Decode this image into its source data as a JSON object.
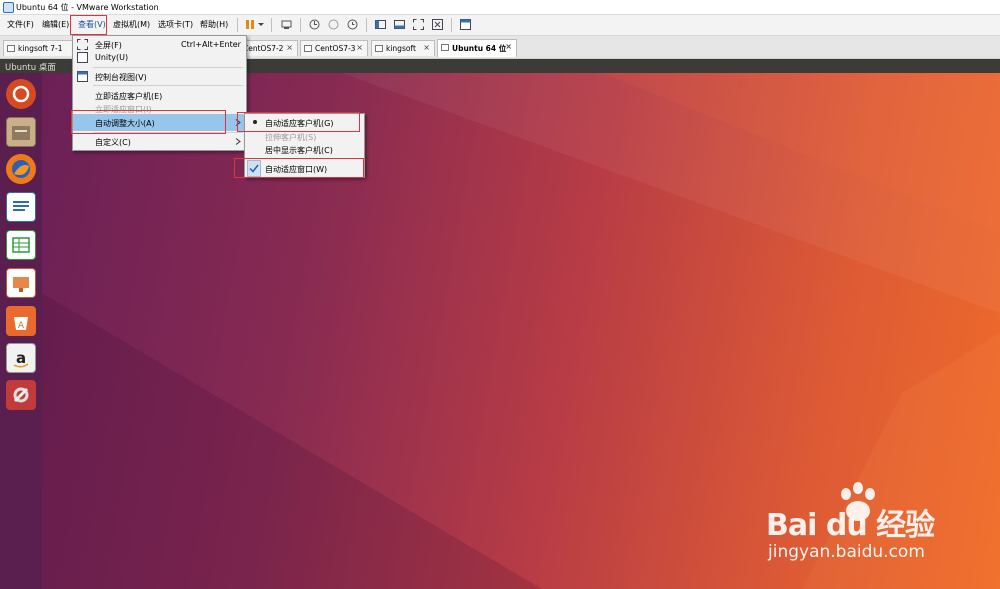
{
  "window": {
    "title": "Ubuntu 64 位 - VMware Workstation"
  },
  "menubar": {
    "items": [
      {
        "label": "文件(F)"
      },
      {
        "label": "编辑(E)"
      },
      {
        "label": "查看(V)"
      },
      {
        "label": "虚拟机(M)"
      },
      {
        "label": "选项卡(T)"
      },
      {
        "label": "帮助(H)"
      }
    ]
  },
  "tabs": [
    {
      "label": "kingsoft 7-1"
    },
    {
      "label": "CentOS7-2"
    },
    {
      "label": "CentOS7-3"
    },
    {
      "label": "kingsoft"
    },
    {
      "label": "Ubuntu 64 位",
      "active": true
    }
  ],
  "tab_close": "×",
  "guest": {
    "panel_title": "Ubuntu 桌面"
  },
  "view_menu": {
    "items": [
      {
        "label": "全屏(F)",
        "shortcut": "Ctrl+Alt+Enter",
        "icon": "fullscreen-icon"
      },
      {
        "label": "Unity(U)",
        "icon": "unity-icon"
      },
      {
        "label": "控制台视图(V)",
        "icon": "console-view-icon"
      },
      {
        "label": "立即适应客户机(E)"
      },
      {
        "label": "立即适应窗口(I)",
        "disabled": true
      },
      {
        "label": "自动调整大小(A)",
        "submenu": true,
        "highlighted": true
      },
      {
        "label": "自定义(C)",
        "submenu": true
      }
    ]
  },
  "autosize_submenu": {
    "items": [
      {
        "label": "自动适应客户机(G)",
        "radio": true
      },
      {
        "label": "拉伸客户机(S)",
        "disabled": true
      },
      {
        "label": "居中显示客户机(C)"
      },
      {
        "label": "自动适应窗口(W)",
        "checked": true
      }
    ]
  },
  "watermark": {
    "brand": "Bai du 经验",
    "url": "jingyan.baidu.com"
  },
  "colors": {
    "highlight": "#98c5ea",
    "annotation_red": "#e0323a",
    "launcher_bg": "#5a1e4f"
  }
}
